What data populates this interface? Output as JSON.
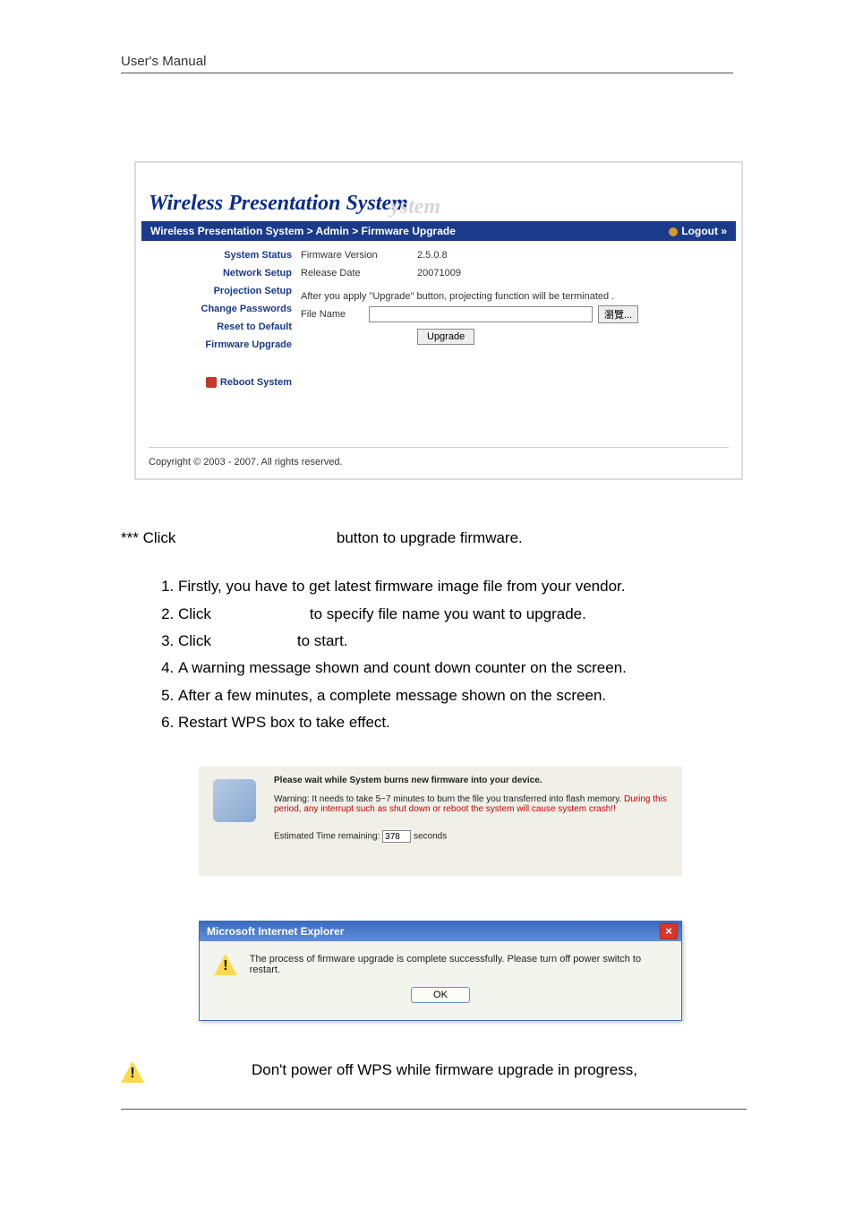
{
  "header": {
    "title": "User's Manual"
  },
  "panel": {
    "app_title": "Wireless Presentation System",
    "breadcrumb": "Wireless Presentation System > Admin > Firmware Upgrade",
    "logout": "Logout »",
    "sidebar": {
      "items": [
        "System Status",
        "Network Setup",
        "Projection Setup",
        "Change Passwords",
        "Reset to Default",
        "Firmware Upgrade"
      ],
      "reboot": "Reboot System"
    },
    "rows": {
      "fw_label": "Firmware Version",
      "fw_value": "2.5.0.8",
      "rel_label": "Release Date",
      "rel_value": "20071009",
      "warn": "After you apply \"Upgrade\" button, projecting function will be terminated .",
      "file_label": "File Name",
      "browse": "瀏覽...",
      "upgrade": "Upgrade"
    },
    "copyright": "Copyright © 2003 - 2007. All rights reserved."
  },
  "text": {
    "click_line_pre": "*** Click",
    "click_line_post": "button to upgrade firmware.",
    "steps": [
      "Firstly, you have to get latest firmware image file from your vendor.",
      "Click                to specify file name you want to upgrade.",
      "Click              to start.",
      "A warning message shown and count down counter on the screen.",
      "After a few minutes, a complete message shown on the screen.",
      "Restart WPS box to take effect."
    ],
    "step2_pre": "Click",
    "step2_post": "to specify file name you want to upgrade.",
    "step3_pre": "Click",
    "step3_post": "to start."
  },
  "wait_panel": {
    "title": "Please wait while System burns new firmware into your device.",
    "warn_pre": "Warning: It needs to take 5~7 minutes to burn the file you transferred into flash memory. ",
    "warn_red": "During this period, any interrupt such as shut down or reboot the system will cause system crash!!",
    "timer_label_pre": "Estimated Time remaining:",
    "timer_value": "378",
    "timer_label_post": "seconds"
  },
  "dialog": {
    "title": "Microsoft Internet Explorer",
    "close": "×",
    "message": "The process of firmware upgrade is complete successfully. Please turn off power switch to restart.",
    "ok": "OK"
  },
  "footer_warn": "Don't power off WPS while firmware upgrade in progress,"
}
